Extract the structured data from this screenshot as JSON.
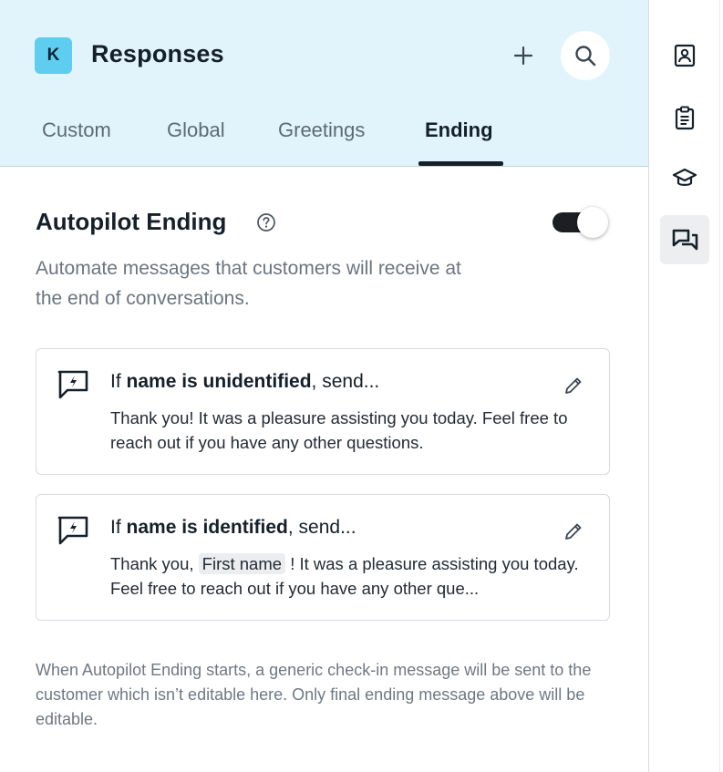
{
  "header": {
    "badge": "K",
    "title": "Responses",
    "tabs": [
      {
        "label": "Custom"
      },
      {
        "label": "Global"
      },
      {
        "label": "Greetings"
      },
      {
        "label": "Ending",
        "active": true
      }
    ]
  },
  "section": {
    "title": "Autopilot Ending",
    "description": "Automate messages that customers will receive at the end of conversations.",
    "toggle_on": true
  },
  "cards": [
    {
      "heading_prefix": "If ",
      "heading_bold": "name is unidentified",
      "heading_suffix": ", send...",
      "body": "Thank you! It was a pleasure assisting you today. Feel free to reach out if you have any other questions."
    },
    {
      "heading_prefix": "If ",
      "heading_bold": "name is identified",
      "heading_suffix": ", send...",
      "body_before": "Thank you, ",
      "chip": "First name",
      "body_after": " ! It was a pleasure assisting you today. Feel free to reach out if you have any other que..."
    }
  ],
  "footer_note": "When Autopilot Ending starts, a generic check-in message will be sent to the customer which isn’t editable here. Only final ending message above will be editable.",
  "rail": {
    "items": [
      {
        "icon": "contact-card-icon"
      },
      {
        "icon": "clipboard-icon"
      },
      {
        "icon": "graduation-cap-icon"
      },
      {
        "icon": "chat-bubbles-icon",
        "active": true
      }
    ]
  },
  "colors": {
    "header_bg": "#e2f4fb",
    "badge_bg": "#5ecdef",
    "text_primary": "#15202b",
    "text_muted": "#6a7580"
  }
}
